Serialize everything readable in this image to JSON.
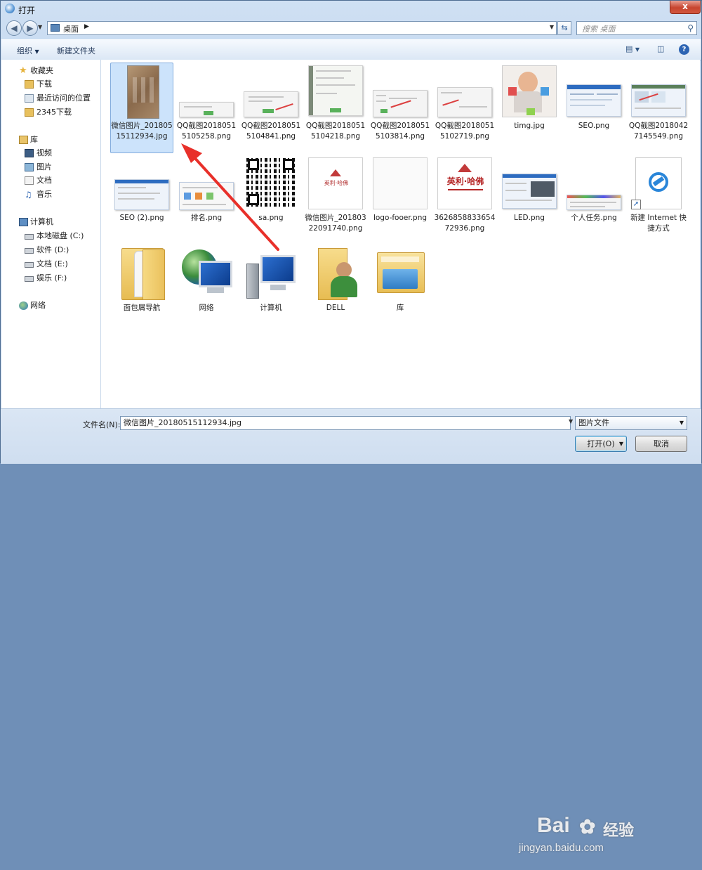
{
  "window": {
    "title": "打开",
    "close_glyph": "x"
  },
  "address": {
    "location": "桌面",
    "search_placeholder": "搜索 桌面"
  },
  "toolbar": {
    "organize": "组织",
    "new_folder": "新建文件夹"
  },
  "sidebar": {
    "favorites": {
      "label": "收藏夹",
      "items": [
        "下载",
        "最近访问的位置",
        "2345下载"
      ]
    },
    "libraries": {
      "label": "库",
      "items": [
        "视频",
        "图片",
        "文档",
        "音乐"
      ]
    },
    "computer": {
      "label": "计算机",
      "items": [
        "本地磁盘 (C:)",
        "软件 (D:)",
        "文档 (E:)",
        "娱乐 (F:)"
      ]
    },
    "network": {
      "label": "网络"
    }
  },
  "files": [
    {
      "name": "微信图片_20180515112934.jpg",
      "selected": true
    },
    {
      "name": "QQ截图20180515105258.png"
    },
    {
      "name": "QQ截图20180515104841.png"
    },
    {
      "name": "QQ截图20180515104218.png"
    },
    {
      "name": "QQ截图20180515103814.png"
    },
    {
      "name": "QQ截图20180515102719.png"
    },
    {
      "name": "timg.jpg"
    },
    {
      "name": "SEO.png"
    },
    {
      "name": "QQ截图20180427145549.png"
    },
    {
      "name": "SEO (2).png"
    },
    {
      "name": "排名.png"
    },
    {
      "name": "sa.png"
    },
    {
      "name": "微信图片_20180322091740.png"
    },
    {
      "name": "logo-fooer.png"
    },
    {
      "name": "362685883365472936.png"
    },
    {
      "name": "LED.png"
    },
    {
      "name": "个人任务.png"
    },
    {
      "name": "新建 Internet 快捷方式"
    },
    {
      "name": "面包屑导航"
    },
    {
      "name": "网络"
    },
    {
      "name": "计算机"
    },
    {
      "name": "DELL"
    },
    {
      "name": "库"
    }
  ],
  "thumb_text": {
    "harry_logo": "英利·哈佛"
  },
  "bottom": {
    "filename_label": "文件名(N):",
    "filename_value": "微信图片_20180515112934.jpg",
    "filetype_value": "图片文件",
    "open_button": "打开(O)",
    "cancel_button": "取消"
  },
  "watermark": {
    "brand": "Bai",
    "brand2": "经验",
    "url": "jingyan.baidu.com"
  },
  "colors": {
    "selection": "#cce3fb",
    "annotation_arrow": "#e8302a",
    "close_button": "#c7452f"
  }
}
